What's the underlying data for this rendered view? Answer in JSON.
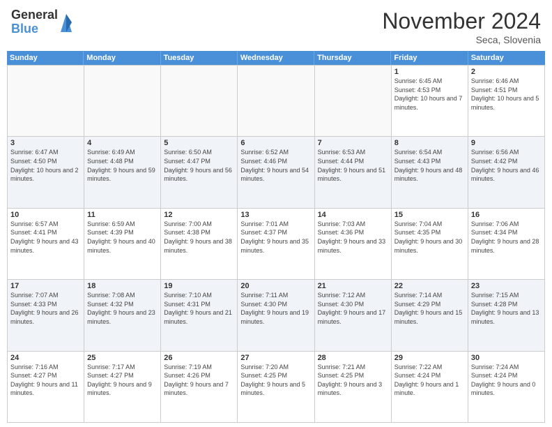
{
  "header": {
    "logo_general": "General",
    "logo_blue": "Blue",
    "month_title": "November 2024",
    "location": "Seca, Slovenia"
  },
  "weekdays": [
    "Sunday",
    "Monday",
    "Tuesday",
    "Wednesday",
    "Thursday",
    "Friday",
    "Saturday"
  ],
  "weeks": [
    [
      {
        "day": "",
        "sunrise": "",
        "sunset": "",
        "daylight": "",
        "empty": true
      },
      {
        "day": "",
        "sunrise": "",
        "sunset": "",
        "daylight": "",
        "empty": true
      },
      {
        "day": "",
        "sunrise": "",
        "sunset": "",
        "daylight": "",
        "empty": true
      },
      {
        "day": "",
        "sunrise": "",
        "sunset": "",
        "daylight": "",
        "empty": true
      },
      {
        "day": "",
        "sunrise": "",
        "sunset": "",
        "daylight": "",
        "empty": true
      },
      {
        "day": "1",
        "sunrise": "Sunrise: 6:45 AM",
        "sunset": "Sunset: 4:53 PM",
        "daylight": "Daylight: 10 hours and 7 minutes.",
        "empty": false
      },
      {
        "day": "2",
        "sunrise": "Sunrise: 6:46 AM",
        "sunset": "Sunset: 4:51 PM",
        "daylight": "Daylight: 10 hours and 5 minutes.",
        "empty": false
      }
    ],
    [
      {
        "day": "3",
        "sunrise": "Sunrise: 6:47 AM",
        "sunset": "Sunset: 4:50 PM",
        "daylight": "Daylight: 10 hours and 2 minutes.",
        "empty": false
      },
      {
        "day": "4",
        "sunrise": "Sunrise: 6:49 AM",
        "sunset": "Sunset: 4:48 PM",
        "daylight": "Daylight: 9 hours and 59 minutes.",
        "empty": false
      },
      {
        "day": "5",
        "sunrise": "Sunrise: 6:50 AM",
        "sunset": "Sunset: 4:47 PM",
        "daylight": "Daylight: 9 hours and 56 minutes.",
        "empty": false
      },
      {
        "day": "6",
        "sunrise": "Sunrise: 6:52 AM",
        "sunset": "Sunset: 4:46 PM",
        "daylight": "Daylight: 9 hours and 54 minutes.",
        "empty": false
      },
      {
        "day": "7",
        "sunrise": "Sunrise: 6:53 AM",
        "sunset": "Sunset: 4:44 PM",
        "daylight": "Daylight: 9 hours and 51 minutes.",
        "empty": false
      },
      {
        "day": "8",
        "sunrise": "Sunrise: 6:54 AM",
        "sunset": "Sunset: 4:43 PM",
        "daylight": "Daylight: 9 hours and 48 minutes.",
        "empty": false
      },
      {
        "day": "9",
        "sunrise": "Sunrise: 6:56 AM",
        "sunset": "Sunset: 4:42 PM",
        "daylight": "Daylight: 9 hours and 46 minutes.",
        "empty": false
      }
    ],
    [
      {
        "day": "10",
        "sunrise": "Sunrise: 6:57 AM",
        "sunset": "Sunset: 4:41 PM",
        "daylight": "Daylight: 9 hours and 43 minutes.",
        "empty": false
      },
      {
        "day": "11",
        "sunrise": "Sunrise: 6:59 AM",
        "sunset": "Sunset: 4:39 PM",
        "daylight": "Daylight: 9 hours and 40 minutes.",
        "empty": false
      },
      {
        "day": "12",
        "sunrise": "Sunrise: 7:00 AM",
        "sunset": "Sunset: 4:38 PM",
        "daylight": "Daylight: 9 hours and 38 minutes.",
        "empty": false
      },
      {
        "day": "13",
        "sunrise": "Sunrise: 7:01 AM",
        "sunset": "Sunset: 4:37 PM",
        "daylight": "Daylight: 9 hours and 35 minutes.",
        "empty": false
      },
      {
        "day": "14",
        "sunrise": "Sunrise: 7:03 AM",
        "sunset": "Sunset: 4:36 PM",
        "daylight": "Daylight: 9 hours and 33 minutes.",
        "empty": false
      },
      {
        "day": "15",
        "sunrise": "Sunrise: 7:04 AM",
        "sunset": "Sunset: 4:35 PM",
        "daylight": "Daylight: 9 hours and 30 minutes.",
        "empty": false
      },
      {
        "day": "16",
        "sunrise": "Sunrise: 7:06 AM",
        "sunset": "Sunset: 4:34 PM",
        "daylight": "Daylight: 9 hours and 28 minutes.",
        "empty": false
      }
    ],
    [
      {
        "day": "17",
        "sunrise": "Sunrise: 7:07 AM",
        "sunset": "Sunset: 4:33 PM",
        "daylight": "Daylight: 9 hours and 26 minutes.",
        "empty": false
      },
      {
        "day": "18",
        "sunrise": "Sunrise: 7:08 AM",
        "sunset": "Sunset: 4:32 PM",
        "daylight": "Daylight: 9 hours and 23 minutes.",
        "empty": false
      },
      {
        "day": "19",
        "sunrise": "Sunrise: 7:10 AM",
        "sunset": "Sunset: 4:31 PM",
        "daylight": "Daylight: 9 hours and 21 minutes.",
        "empty": false
      },
      {
        "day": "20",
        "sunrise": "Sunrise: 7:11 AM",
        "sunset": "Sunset: 4:30 PM",
        "daylight": "Daylight: 9 hours and 19 minutes.",
        "empty": false
      },
      {
        "day": "21",
        "sunrise": "Sunrise: 7:12 AM",
        "sunset": "Sunset: 4:30 PM",
        "daylight": "Daylight: 9 hours and 17 minutes.",
        "empty": false
      },
      {
        "day": "22",
        "sunrise": "Sunrise: 7:14 AM",
        "sunset": "Sunset: 4:29 PM",
        "daylight": "Daylight: 9 hours and 15 minutes.",
        "empty": false
      },
      {
        "day": "23",
        "sunrise": "Sunrise: 7:15 AM",
        "sunset": "Sunset: 4:28 PM",
        "daylight": "Daylight: 9 hours and 13 minutes.",
        "empty": false
      }
    ],
    [
      {
        "day": "24",
        "sunrise": "Sunrise: 7:16 AM",
        "sunset": "Sunset: 4:27 PM",
        "daylight": "Daylight: 9 hours and 11 minutes.",
        "empty": false
      },
      {
        "day": "25",
        "sunrise": "Sunrise: 7:17 AM",
        "sunset": "Sunset: 4:27 PM",
        "daylight": "Daylight: 9 hours and 9 minutes.",
        "empty": false
      },
      {
        "day": "26",
        "sunrise": "Sunrise: 7:19 AM",
        "sunset": "Sunset: 4:26 PM",
        "daylight": "Daylight: 9 hours and 7 minutes.",
        "empty": false
      },
      {
        "day": "27",
        "sunrise": "Sunrise: 7:20 AM",
        "sunset": "Sunset: 4:25 PM",
        "daylight": "Daylight: 9 hours and 5 minutes.",
        "empty": false
      },
      {
        "day": "28",
        "sunrise": "Sunrise: 7:21 AM",
        "sunset": "Sunset: 4:25 PM",
        "daylight": "Daylight: 9 hours and 3 minutes.",
        "empty": false
      },
      {
        "day": "29",
        "sunrise": "Sunrise: 7:22 AM",
        "sunset": "Sunset: 4:24 PM",
        "daylight": "Daylight: 9 hours and 1 minute.",
        "empty": false
      },
      {
        "day": "30",
        "sunrise": "Sunrise: 7:24 AM",
        "sunset": "Sunset: 4:24 PM",
        "daylight": "Daylight: 9 hours and 0 minutes.",
        "empty": false
      }
    ]
  ]
}
